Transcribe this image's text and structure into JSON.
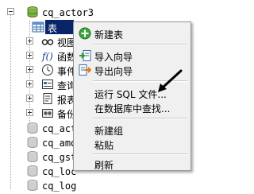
{
  "tree": {
    "db_name": "cq_actor3",
    "items": [
      {
        "label": "表",
        "icon": "table-icon"
      },
      {
        "label": "视图",
        "icon": "glasses-icon"
      },
      {
        "label": "函数",
        "icon": "function-icon"
      },
      {
        "label": "事件",
        "icon": "clock-icon"
      },
      {
        "label": "查询",
        "icon": "query-icon"
      },
      {
        "label": "报表",
        "icon": "report-icon"
      },
      {
        "label": "备份",
        "icon": "backup-icon"
      }
    ],
    "other_dbs": [
      {
        "label": "cq_actor"
      },
      {
        "label": "cq_amd"
      },
      {
        "label": "cq_gst"
      },
      {
        "label": "cq_loc"
      },
      {
        "label": "cq_log"
      }
    ]
  },
  "context_menu": {
    "new_table": "新建表",
    "import_wizard": "导入向导",
    "export_wizard": "导出向导",
    "run_sql_file": "运行 SQL 文件...",
    "find_in_db": "在数据库中查找...",
    "new_group": "新建组",
    "paste": "粘贴",
    "refresh": "刷新"
  },
  "colors": {
    "selection": "#0a246a",
    "menu_bg": "#f0f0f0",
    "annotation_arrow": "#000000"
  }
}
